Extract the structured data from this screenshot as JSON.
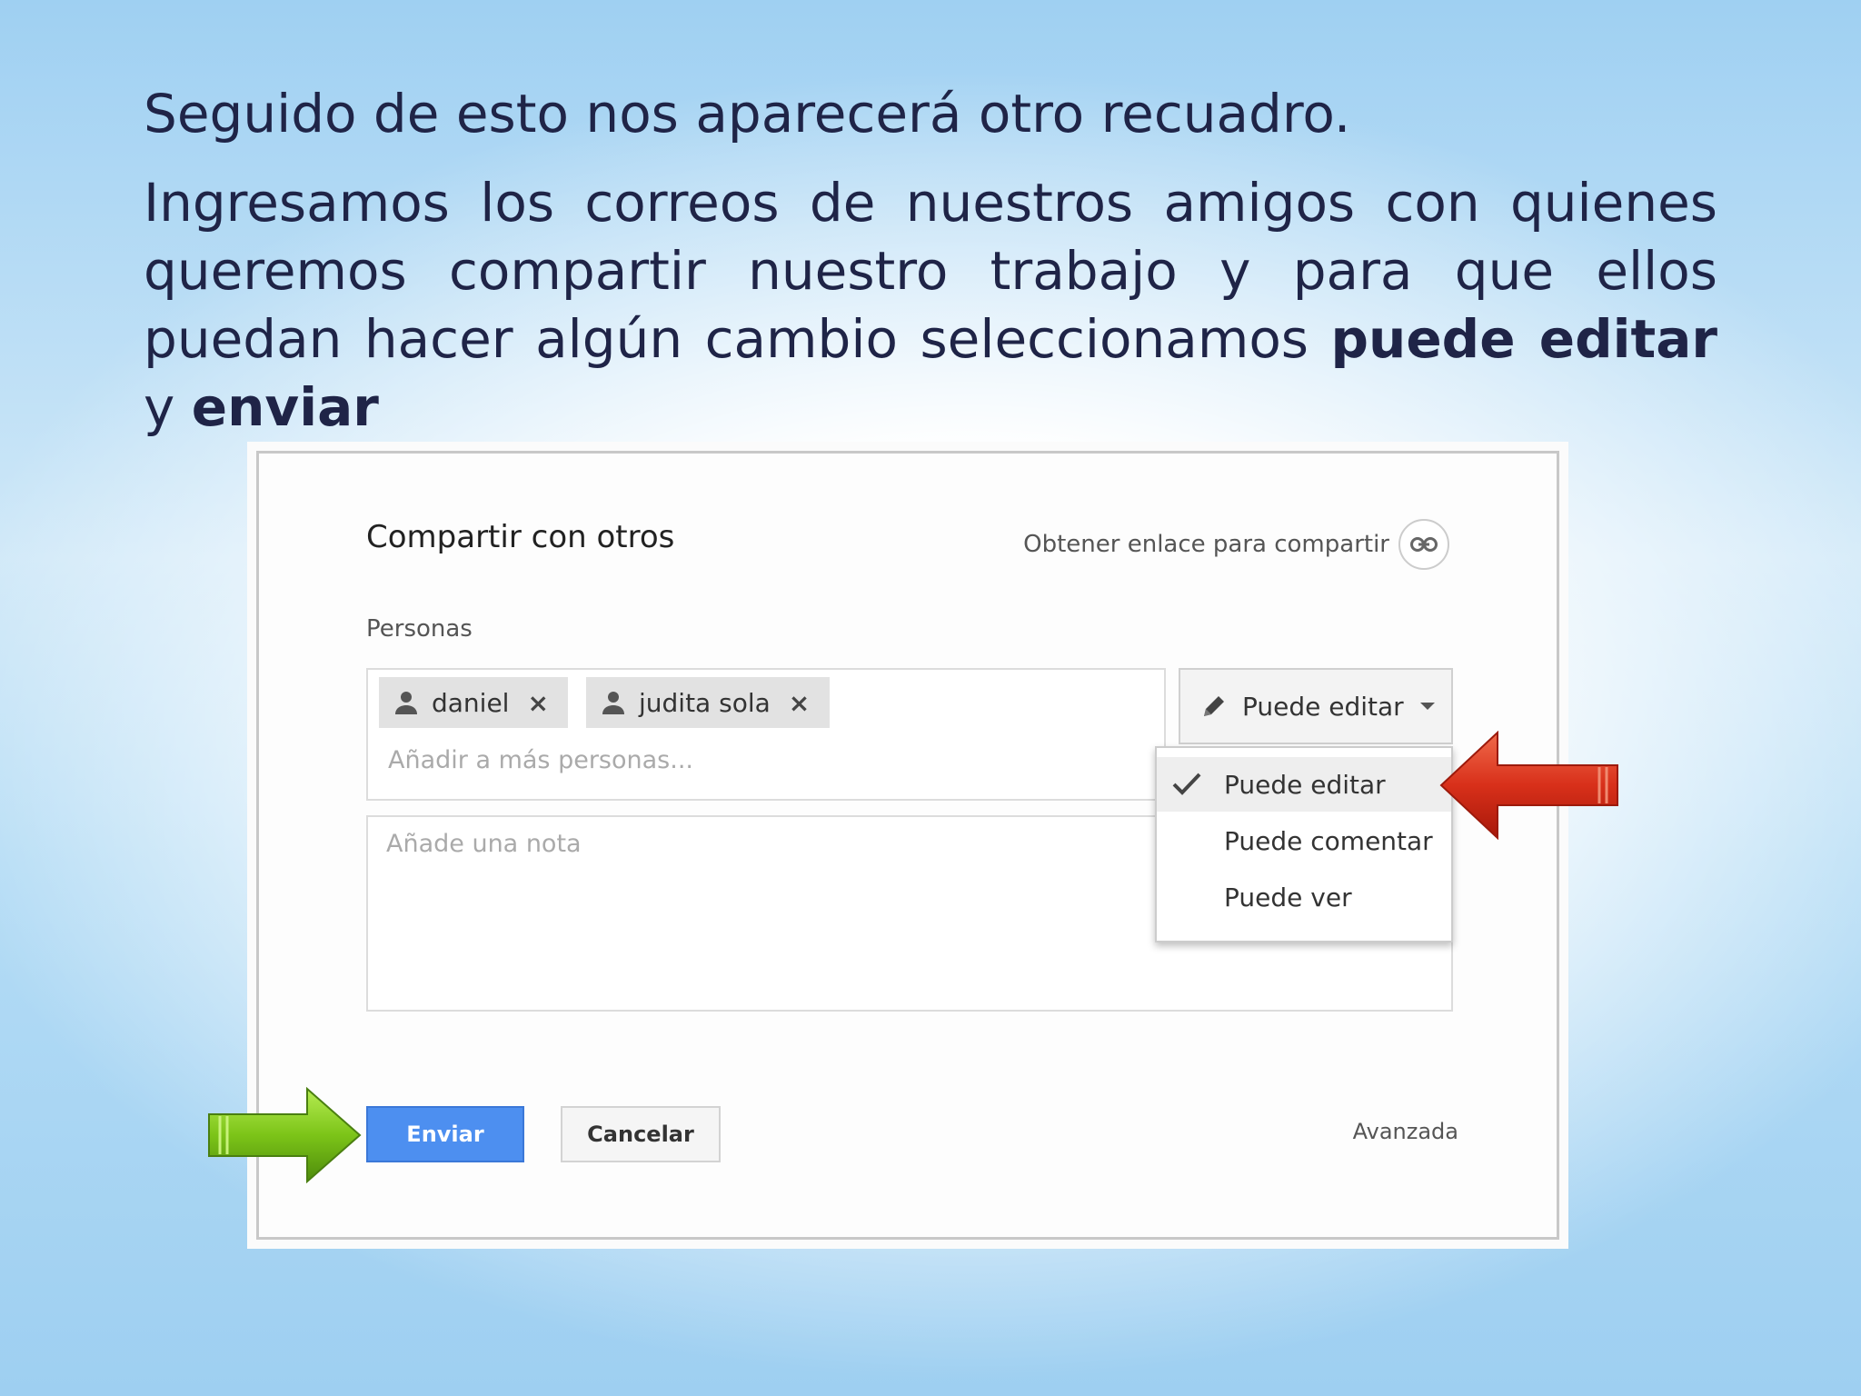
{
  "slide": {
    "line1": "Seguido de esto nos aparecerá otro recuadro.",
    "p2_part1": "Ingresamos los correos de nuestros amigos con quienes queremos compartir nuestro trabajo y para que ellos puedan hacer algún cambio seleccionamos ",
    "p2_bold1": "puede editar",
    "p2_part2": " y ",
    "p2_bold2": "enviar"
  },
  "dialog": {
    "title": "Compartir con otros",
    "get_link_label": "Obtener enlace para compartir",
    "people_label": "Personas",
    "chips": [
      {
        "name": "daniel"
      },
      {
        "name": "judita sola"
      }
    ],
    "chip_remove": "×",
    "add_people_placeholder": "Añadir a más personas...",
    "note_placeholder": "Añade una nota",
    "permission_selected": "Puede editar",
    "permission_options": [
      "Puede editar",
      "Puede comentar",
      "Puede ver"
    ],
    "send_label": "Enviar",
    "cancel_label": "Cancelar",
    "advanced_label": "Avanzada"
  },
  "colors": {
    "text_dark": "#1f2447",
    "send_blue": "#4d8ff0",
    "arrow_red": "#d8301a",
    "arrow_green": "#7cc418"
  }
}
